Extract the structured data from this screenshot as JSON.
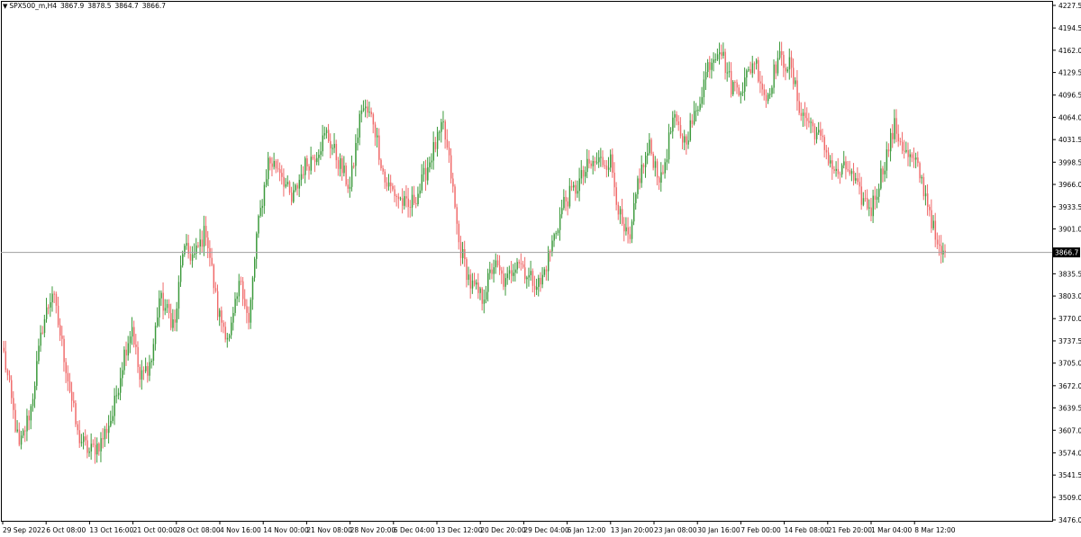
{
  "chart_data": {
    "type": "candlestick",
    "symbol": "SPX500_m",
    "timeframe": "H4",
    "header_values": [
      "3867.9",
      "3878.5",
      "3864.7",
      "3866.7"
    ],
    "current_price": 3866.7,
    "current_price_label": "3866.7",
    "ylim": [
      3476.0,
      4227.5
    ],
    "y_ticks": [
      4227.5,
      4194.5,
      4162.0,
      4129.5,
      4096.5,
      4064.0,
      4031.5,
      3998.5,
      3966.0,
      3933.5,
      3901.0,
      3835.5,
      3803.0,
      3770.0,
      3737.5,
      3705.0,
      3672.0,
      3639.5,
      3607.0,
      3574.0,
      3541.5,
      3509.0,
      3476.0
    ],
    "y_tick_labels": [
      "4227.5",
      "4194.5",
      "4162.0",
      "4129.5",
      "4096.5",
      "4064.0",
      "4031.5",
      "3998.5",
      "3966.0",
      "3933.5",
      "3901.0",
      "3835.5",
      "3803.0",
      "3770.0",
      "3737.5",
      "3705.0",
      "3672.0",
      "3639.5",
      "3607.0",
      "3574.0",
      "3541.5",
      "3509.0",
      "3476.0"
    ],
    "x_labels": [
      "29 Sep 2022",
      "6 Oct 08:00",
      "13 Oct 16:00",
      "21 Oct 00:00",
      "28 Oct 08:00",
      "4 Nov 16:00",
      "14 Nov 00:00",
      "21 Nov 08:00",
      "28 Nov 20:00",
      "6 Dec 04:00",
      "13 Dec 12:00",
      "20 Dec 20:00",
      "29 Dec 04:00",
      "6 Jan 12:00",
      "13 Jan 20:00",
      "23 Jan 08:00",
      "30 Jan 16:00",
      "7 Feb 00:00",
      "14 Feb 08:00",
      "21 Feb 20:00",
      "1 Mar 04:00",
      "8 Mar 12:00"
    ],
    "close_anchors": [
      [
        0,
        3718
      ],
      [
        8,
        3580
      ],
      [
        14,
        3640
      ],
      [
        20,
        3760
      ],
      [
        25,
        3810
      ],
      [
        32,
        3700
      ],
      [
        38,
        3600
      ],
      [
        44,
        3575
      ],
      [
        50,
        3590
      ],
      [
        56,
        3630
      ],
      [
        62,
        3720
      ],
      [
        66,
        3760
      ],
      [
        70,
        3680
      ],
      [
        76,
        3710
      ],
      [
        80,
        3800
      ],
      [
        88,
        3760
      ],
      [
        92,
        3870
      ],
      [
        98,
        3860
      ],
      [
        104,
        3900
      ],
      [
        110,
        3780
      ],
      [
        116,
        3740
      ],
      [
        122,
        3830
      ],
      [
        126,
        3760
      ],
      [
        130,
        3890
      ],
      [
        136,
        4000
      ],
      [
        142,
        3990
      ],
      [
        148,
        3940
      ],
      [
        154,
        3990
      ],
      [
        160,
        4010
      ],
      [
        166,
        4040
      ],
      [
        172,
        4000
      ],
      [
        178,
        3960
      ],
      [
        184,
        4080
      ],
      [
        190,
        4060
      ],
      [
        196,
        3970
      ],
      [
        202,
        3950
      ],
      [
        208,
        3930
      ],
      [
        214,
        3960
      ],
      [
        220,
        4010
      ],
      [
        226,
        4050
      ],
      [
        230,
        3980
      ],
      [
        234,
        3880
      ],
      [
        240,
        3820
      ],
      [
        246,
        3800
      ],
      [
        252,
        3850
      ],
      [
        258,
        3820
      ],
      [
        264,
        3860
      ],
      [
        270,
        3830
      ],
      [
        276,
        3820
      ],
      [
        282,
        3880
      ],
      [
        288,
        3940
      ],
      [
        294,
        3960
      ],
      [
        300,
        3990
      ],
      [
        306,
        4000
      ],
      [
        312,
        4000
      ],
      [
        318,
        3900
      ],
      [
        322,
        3880
      ],
      [
        326,
        3970
      ],
      [
        332,
        4020
      ],
      [
        338,
        3970
      ],
      [
        344,
        4060
      ],
      [
        350,
        4030
      ],
      [
        356,
        4070
      ],
      [
        362,
        4140
      ],
      [
        368,
        4170
      ],
      [
        374,
        4110
      ],
      [
        380,
        4110
      ],
      [
        386,
        4150
      ],
      [
        392,
        4090
      ],
      [
        398,
        4150
      ],
      [
        404,
        4140
      ],
      [
        410,
        4070
      ],
      [
        416,
        4050
      ],
      [
        422,
        4020
      ],
      [
        428,
        3980
      ],
      [
        434,
        3990
      ],
      [
        440,
        3950
      ],
      [
        446,
        3930
      ],
      [
        452,
        3990
      ],
      [
        458,
        4050
      ],
      [
        464,
        4010
      ],
      [
        470,
        3990
      ],
      [
        476,
        3930
      ],
      [
        480,
        3870
      ],
      [
        484,
        3860
      ]
    ]
  }
}
